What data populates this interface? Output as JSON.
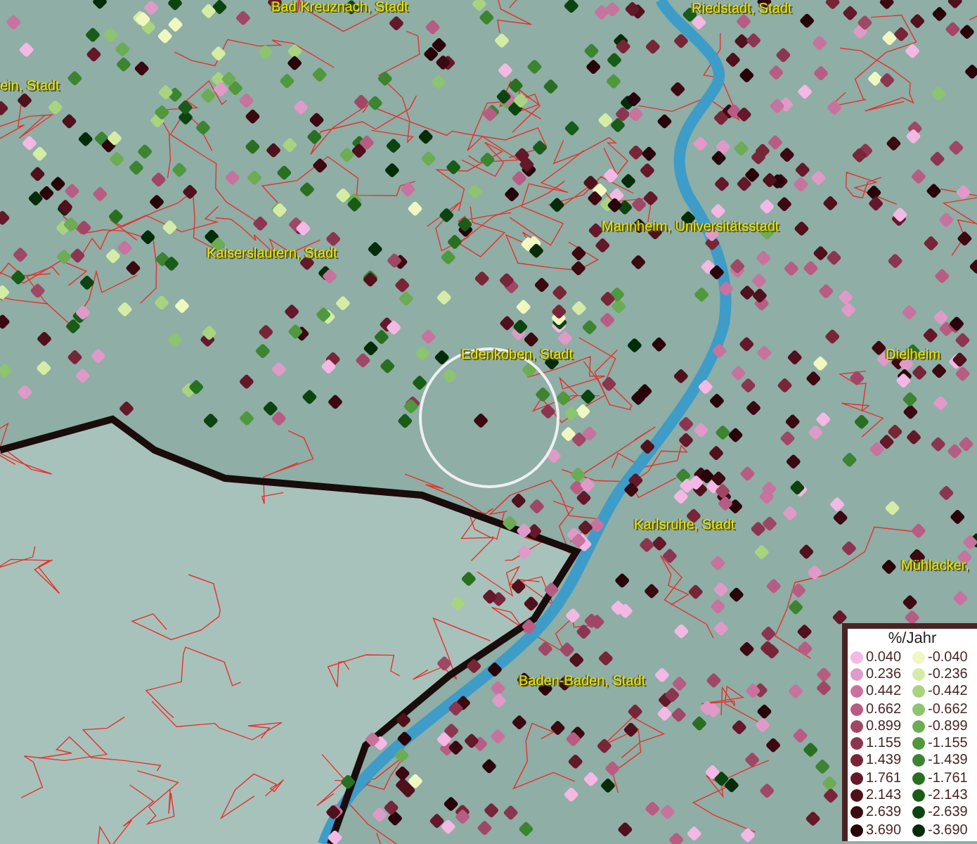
{
  "map": {
    "labels": [
      {
        "text": "Bad Kreuznach, Stadt"
      },
      {
        "text": "Riedstadt, Stadt"
      },
      {
        "text": "ein, Stadt"
      },
      {
        "text": "Kaiserslautern, Stadt"
      },
      {
        "text": "Mannheim, Universitätsstadt"
      },
      {
        "text": "Edenkoben, Stadt"
      },
      {
        "text": "Dielheim"
      },
      {
        "text": "Karlsruhe, Stadt"
      },
      {
        "text": "Mühlacker,"
      },
      {
        "text": "Baden-Baden, Stadt"
      }
    ]
  },
  "legend": {
    "title": "%/Jahr",
    "rows": [
      {
        "positive": {
          "value": "0.040",
          "color": "#f4b8e4"
        },
        "negative": {
          "value": "-0.040",
          "color": "#f0f8c0"
        }
      },
      {
        "positive": {
          "value": "0.236",
          "color": "#e09ac8"
        },
        "negative": {
          "value": "-0.236",
          "color": "#d4eca4"
        }
      },
      {
        "positive": {
          "value": "0.442",
          "color": "#c8729e"
        },
        "negative": {
          "value": "-0.442",
          "color": "#a8d480"
        }
      },
      {
        "positive": {
          "value": "0.662",
          "color": "#b85c84"
        },
        "negative": {
          "value": "-0.662",
          "color": "#8cc470"
        }
      },
      {
        "positive": {
          "value": "0.899",
          "color": "#a04766"
        },
        "negative": {
          "value": "-0.899",
          "color": "#6cac54"
        }
      },
      {
        "positive": {
          "value": "1.155",
          "color": "#8c3550"
        },
        "negative": {
          "value": "-1.155",
          "color": "#50983c"
        }
      },
      {
        "positive": {
          "value": "1.439",
          "color": "#782538"
        },
        "negative": {
          "value": "-1.439",
          "color": "#3c8430"
        }
      },
      {
        "positive": {
          "value": "1.761",
          "color": "#64182a"
        },
        "negative": {
          "value": "-1.761",
          "color": "#287020"
        }
      },
      {
        "positive": {
          "value": "2.143",
          "color": "#50101c"
        },
        "negative": {
          "value": "-2.143",
          "color": "#185c18"
        }
      },
      {
        "positive": {
          "value": "2.639",
          "color": "#3c0812"
        },
        "negative": {
          "value": "-2.639",
          "color": "#0c4410"
        }
      },
      {
        "positive": {
          "value": "3.690",
          "color": "#28040a"
        },
        "negative": {
          "value": "-3.690",
          "color": "#042c08"
        }
      }
    ]
  }
}
